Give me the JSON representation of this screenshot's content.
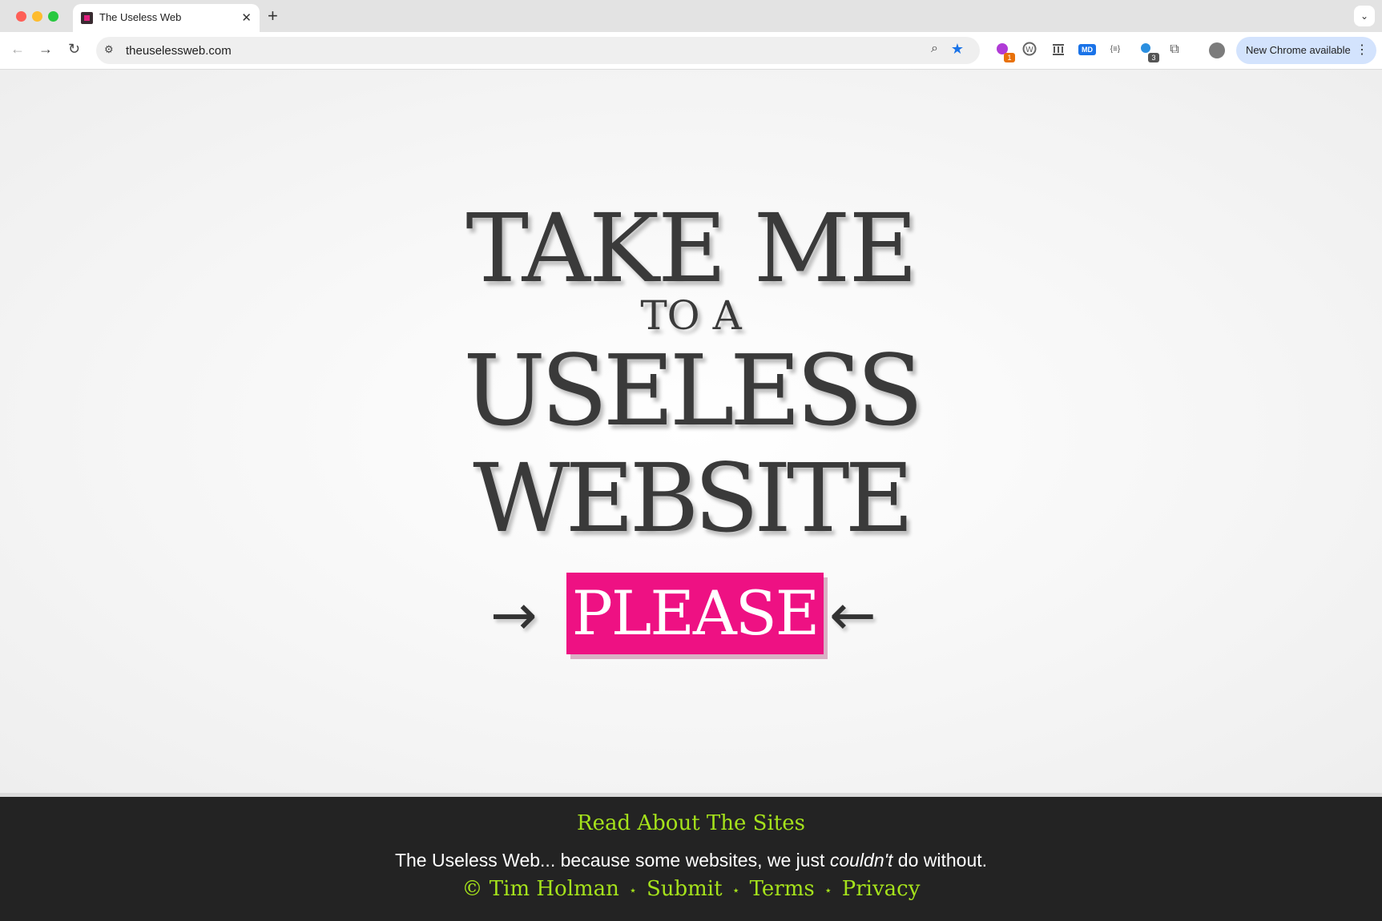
{
  "browser": {
    "tab_title": "The Useless Web",
    "tab_close": "✕",
    "new_tab": "+",
    "tab_menu": "⌄",
    "url": "theuselessweb.com",
    "update_button": "New Chrome available",
    "update_menu": "⋮",
    "extensions": [
      {
        "name": "ext-1-icon",
        "badge": "1"
      },
      {
        "name": "ext-wordpress-icon",
        "badge": ""
      },
      {
        "name": "ext-archive-icon",
        "badge": ""
      },
      {
        "name": "ext-md-icon",
        "label": "MD",
        "badge": ""
      },
      {
        "name": "ext-json-icon",
        "label": "{≡}",
        "badge": ""
      },
      {
        "name": "ext-2-icon",
        "badge": "3"
      }
    ]
  },
  "hero": {
    "line1": "TAKE ME",
    "line2": "TO A",
    "line3": "USELESS",
    "line4": "WEBSITE",
    "button": "PLEASE",
    "arrow_left": "→",
    "arrow_right": "←"
  },
  "footer": {
    "title_link": "Read About The Sites",
    "tagline_before": "The Useless Web... because some websites, we just ",
    "tagline_em": "couldn't",
    "tagline_after": " do without.",
    "links": [
      "© Tim Holman",
      "Submit",
      "Terms",
      "Privacy"
    ],
    "separator": "⋆"
  },
  "colors": {
    "button": "#ee1183",
    "footer_bg": "#232323",
    "footer_link": "#a5e21b",
    "headline": "#3a3a3a"
  }
}
